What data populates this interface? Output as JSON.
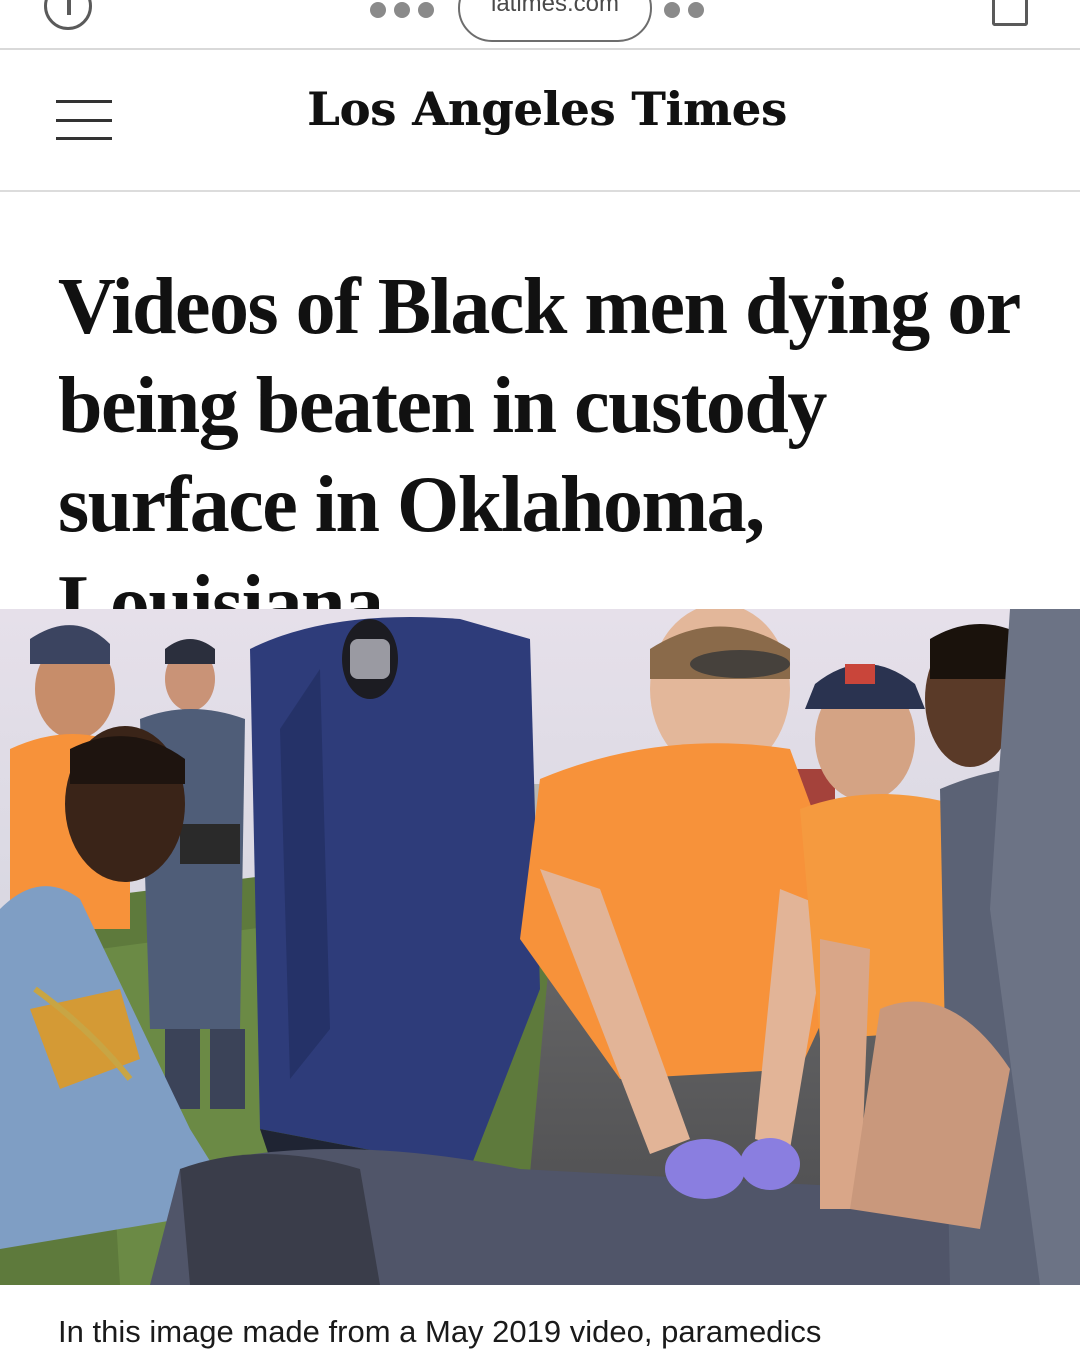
{
  "browser": {
    "url": "latimes.com"
  },
  "header": {
    "logo": "Los Angeles Times"
  },
  "article": {
    "headline": "Videos of Black men dying or being beaten in custody surface in Oklahoma, Louisiana",
    "caption": "In this image made from a May 2019 video, paramedics"
  },
  "icons": {
    "menu": "hamburger-menu-icon",
    "info": "info-icon",
    "share": "share-icon"
  },
  "colors": {
    "paramedic_shirt": "#f7923a",
    "officer_uniform": "#2e3c7a",
    "background_sky": "#d8dce6"
  }
}
